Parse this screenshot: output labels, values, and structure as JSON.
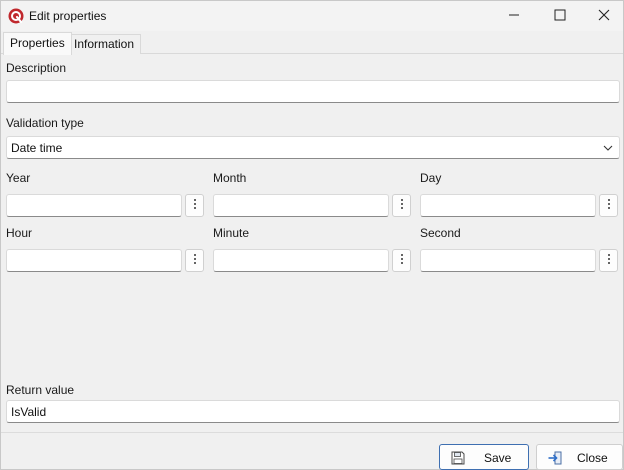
{
  "window": {
    "title": "Edit properties"
  },
  "tabs": [
    {
      "label": "Properties",
      "active": true
    },
    {
      "label": "Information",
      "active": false
    }
  ],
  "form": {
    "description": {
      "label": "Description",
      "value": ""
    },
    "validation_type": {
      "label": "Validation type",
      "selected": "Date time"
    },
    "date_fields": [
      {
        "label": "Year",
        "value": ""
      },
      {
        "label": "Month",
        "value": ""
      },
      {
        "label": "Day",
        "value": ""
      }
    ],
    "time_fields": [
      {
        "label": "Hour",
        "value": ""
      },
      {
        "label": "Minute",
        "value": ""
      },
      {
        "label": "Second",
        "value": ""
      }
    ],
    "return_value": {
      "label": "Return value",
      "value": "IsValid"
    }
  },
  "buttons": {
    "save": "Save",
    "close": "Close"
  },
  "icons": {
    "app": "app-logo-icon",
    "minimize": "minimize-icon",
    "maximize": "maximize-icon",
    "close": "close-icon",
    "dots": "more-vertical-icon",
    "chevron": "chevron-down-icon",
    "save": "save-icon",
    "exit": "exit-icon"
  },
  "colors": {
    "accent": "#3e6fb1",
    "logo": "#c0282d"
  }
}
